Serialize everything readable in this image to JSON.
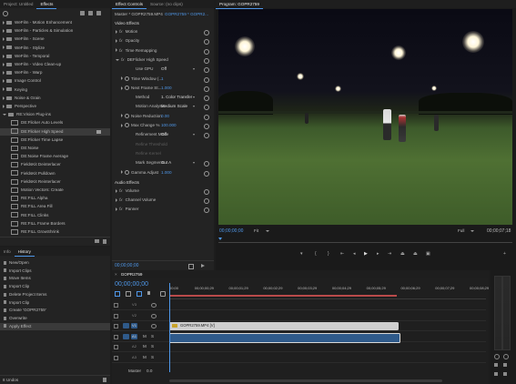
{
  "project": {
    "tabs": [
      "Project: Untitled",
      "Effects"
    ],
    "items": [
      {
        "label": "WeFilm - Motion Enhancement",
        "type": "folder",
        "open": false
      },
      {
        "label": "WeFilm - Particles & Simulation",
        "type": "folder",
        "open": false
      },
      {
        "label": "WeFilm - Scene",
        "type": "folder",
        "open": false
      },
      {
        "label": "WeFilm - Stylize",
        "type": "folder",
        "open": false
      },
      {
        "label": "WeFilm - Temporal",
        "type": "folder",
        "open": false
      },
      {
        "label": "WeFilm - Video Clean-up",
        "type": "folder",
        "open": false
      },
      {
        "label": "WeFilm - Warp",
        "type": "folder",
        "open": false
      },
      {
        "label": "Image Control",
        "type": "folder",
        "open": false
      },
      {
        "label": "Keying",
        "type": "folder",
        "open": false
      },
      {
        "label": "Noise & Grain",
        "type": "folder",
        "open": false
      },
      {
        "label": "Perspective",
        "type": "folder",
        "open": false
      },
      {
        "label": "RE:Vision Plug-ins",
        "type": "folder",
        "open": true
      },
      {
        "label": "DE:Flicker Auto Levels",
        "type": "effect"
      },
      {
        "label": "DE:Flicker High Speed",
        "type": "effect",
        "selected": true
      },
      {
        "label": "DE:Flicker Time Lapse",
        "type": "effect"
      },
      {
        "label": "DE:Noise",
        "type": "effect"
      },
      {
        "label": "DE:Noise Frame Average",
        "type": "effect"
      },
      {
        "label": "FieldsKit Deinterlacer",
        "type": "effect"
      },
      {
        "label": "FieldsKit Pulldown",
        "type": "effect"
      },
      {
        "label": "FieldsKit Reinterlacer",
        "type": "effect"
      },
      {
        "label": "Motion Vectors: Create",
        "type": "effect"
      },
      {
        "label": "RE:FILL Alpha",
        "type": "effect"
      },
      {
        "label": "RE:FILL Area Fill",
        "type": "effect"
      },
      {
        "label": "RE:FILL Clinks",
        "type": "effect"
      },
      {
        "label": "RE:FILL Frame Borders",
        "type": "effect"
      },
      {
        "label": "RE:FILL GrowShrink",
        "type": "effect"
      }
    ]
  },
  "effect_controls": {
    "tabs": [
      "Effect Controls",
      "Source: (no clips)"
    ],
    "breadcrumb": "Master * GOPR2759.MP4",
    "breadcrumb2": "GOPR2759 * GOPR2...",
    "sections": {
      "video": "Video Effects",
      "audio": "Audio Effects"
    },
    "rows": [
      {
        "label": "Motion",
        "kind": "fx"
      },
      {
        "label": "Opacity",
        "kind": "fx"
      },
      {
        "label": "Time Remapping",
        "kind": "fx"
      },
      {
        "label": "DEFlicker High Speed",
        "kind": "fx-open"
      },
      {
        "label": "Use GPU",
        "value": "Off",
        "kind": "param"
      },
      {
        "label": "Time Window (...",
        "value": "1",
        "kind": "param-tri"
      },
      {
        "label": "Next Frame St...",
        "value": "1.000",
        "kind": "param-tri"
      },
      {
        "label": "Method",
        "value": "1. Color Transfer",
        "kind": "param"
      },
      {
        "label": "Motion Analysis",
        "value": "Medium Scale",
        "kind": "param"
      },
      {
        "label": "Noise Reduction",
        "value": "0.00",
        "kind": "param-tri"
      },
      {
        "label": "Max Change %",
        "value": "100.000",
        "kind": "param-tri"
      },
      {
        "label": "Refinement Mode",
        "value": "Off",
        "kind": "param"
      },
      {
        "label": "Refine Threshold",
        "value": "",
        "kind": "param-dim"
      },
      {
        "label": "Refine Kernel",
        "value": "",
        "kind": "param-dim"
      },
      {
        "label": "Mark Segments",
        "value": "Cut A",
        "kind": "param"
      },
      {
        "label": "Gamma Adjust",
        "value": "1.000",
        "kind": "param-tri"
      }
    ],
    "audio_rows": [
      {
        "label": "Volume"
      },
      {
        "label": "Channel Volume"
      },
      {
        "label": "Panner"
      }
    ],
    "timecode": "00;00;00;00"
  },
  "program": {
    "title": "Program: GOPR2759",
    "timecode_left": "00;00;00;00",
    "fit": "Fit",
    "quality": "Full",
    "timecode_right": "00;00;07;18"
  },
  "history": {
    "tabs": [
      "Info",
      "History"
    ],
    "items": [
      "New/Open",
      "Import Clips",
      "Move Items",
      "Import Clip",
      "Delete Project Items",
      "Import Clip",
      "Create 'GOPR2759'",
      "Overwrite",
      "Apply Effect"
    ],
    "status": "8 Undos"
  },
  "timeline": {
    "tab": "GOPR2759",
    "timecode": "00;00;00;00",
    "ruler": [
      "00;00",
      "00;00;00;29",
      "00;00;01;29",
      "00;00;02;29",
      "00;00;03;29",
      "00;00;04;29",
      "00;00;05;29",
      "00;00;06;29",
      "00;00;07;29",
      "00;00;08;29"
    ],
    "tracks": [
      {
        "name": "V3"
      },
      {
        "name": "V2"
      },
      {
        "name": "V1"
      },
      {
        "name": "A1"
      },
      {
        "name": "A2"
      },
      {
        "name": "A3"
      }
    ],
    "track_letters": {
      "m": "M",
      "s": "S"
    },
    "clip_video": "GOPR2759.MP4 [V]",
    "master": "Master",
    "master_value": "0.0"
  },
  "colors": {
    "accent": "#4f97e8",
    "playhead": "#e0463a",
    "clip_video": "#cfcfcf",
    "clip_audio": "#2f5a8a"
  }
}
